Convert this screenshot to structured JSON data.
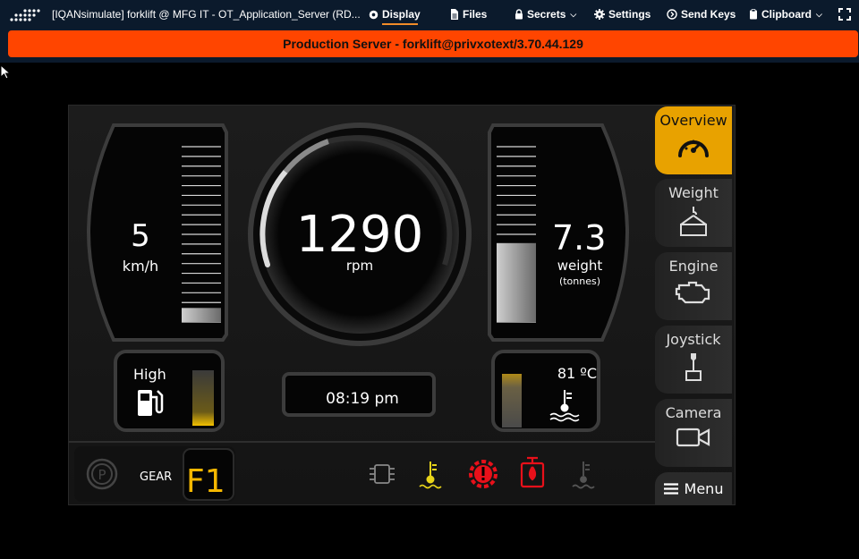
{
  "toolbar": {
    "title": "[IQANsimulate] forklift @ MFG IT - OT_Application_Server (RD...",
    "display": "Display",
    "files": "Files",
    "secrets": "Secrets",
    "settings": "Settings",
    "send_keys": "Send Keys",
    "clipboard": "Clipboard"
  },
  "banner": "Production Server - forklift@privxotext/3.70.44.129",
  "hmi": {
    "speed": {
      "value": "5",
      "unit": "km/h",
      "level": 0.08
    },
    "rpm": {
      "value": "1290",
      "unit": "rpm"
    },
    "weight": {
      "value": "7.3",
      "unit": "weight",
      "sub": "(tonnes)",
      "level": 0.45
    },
    "fuel": {
      "label": "High",
      "level": 1.0
    },
    "time": "08:19 pm",
    "temperature": {
      "value": "81 ºC",
      "level": 1.0
    },
    "gear": {
      "label": "GEAR",
      "value": "F1"
    },
    "menu": {
      "overview": "Overview",
      "weight": "Weight",
      "engine": "Engine",
      "joystick": "Joystick",
      "camera": "Camera",
      "menu": "Menu"
    },
    "colors": {
      "accent": "#e8a200",
      "warning_red": "#e8101a",
      "warning_yellow": "#e8d41a",
      "banner": "#ff4500"
    }
  }
}
